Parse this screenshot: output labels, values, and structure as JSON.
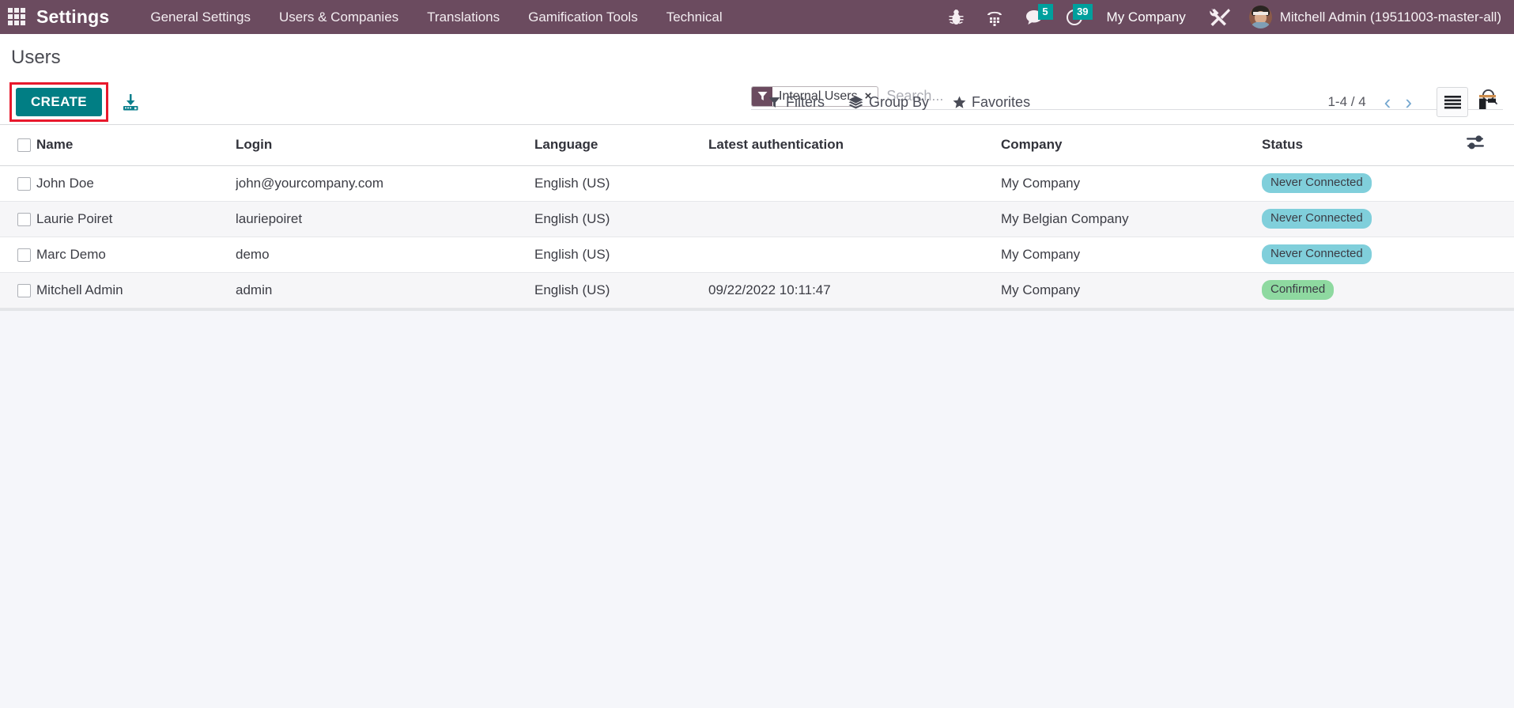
{
  "navbar": {
    "apps_icon": "apps-grid-icon",
    "brand": "Settings",
    "menu": [
      {
        "label": "General Settings"
      },
      {
        "label": "Users & Companies"
      },
      {
        "label": "Translations"
      },
      {
        "label": "Gamification Tools"
      },
      {
        "label": "Technical"
      }
    ],
    "sys_icons": [
      {
        "name": "bug-icon",
        "badge": null
      },
      {
        "name": "voip-dialpad-icon",
        "badge": null
      },
      {
        "name": "messaging-icon",
        "badge": "5"
      },
      {
        "name": "activities-clock-icon",
        "badge": "39"
      }
    ],
    "company": "My Company",
    "debug_icon": "tools-wrench-icon",
    "user": "Mitchell Admin (19511003-master-all)",
    "colors": {
      "background": "#6b4b5f",
      "badge": "#00a09d"
    }
  },
  "control_panel": {
    "breadcrumb": "Users",
    "create_label": "CREATE",
    "create_color": "#017e84",
    "highlight_color": "#e8192c",
    "import_icon": "import-download-icon",
    "search": {
      "facet_label": "Internal Users",
      "facet_icon": "filter-funnel-icon",
      "facet_remove": "×",
      "placeholder": "Search...",
      "value": "",
      "search_icon": "search-magnifier-icon"
    },
    "tools": [
      {
        "label": "Filters",
        "icon": "filter-funnel-icon"
      },
      {
        "label": "Group By",
        "icon": "layers-stack-icon"
      },
      {
        "label": "Favorites",
        "icon": "star-icon"
      }
    ],
    "pager": {
      "range": "1-4 / 4",
      "prev_icon": "chevron-left-icon",
      "next_icon": "chevron-right-icon"
    },
    "views": [
      {
        "name": "list-view",
        "icon": "list-icon",
        "active": true
      },
      {
        "name": "kanban-view",
        "icon": "kanban-icon",
        "active": false
      }
    ]
  },
  "list": {
    "columns": [
      {
        "key": "name",
        "label": "Name"
      },
      {
        "key": "login",
        "label": "Login"
      },
      {
        "key": "lang",
        "label": "Language"
      },
      {
        "key": "auth",
        "label": "Latest authentication"
      },
      {
        "key": "company",
        "label": "Company"
      },
      {
        "key": "status",
        "label": "Status"
      }
    ],
    "optional_columns_icon": "sliders-toggle-icon",
    "rows": [
      {
        "name": "John Doe",
        "login": "john@yourcompany.com",
        "lang": "English (US)",
        "auth": "",
        "company": "My Company",
        "status": "Never Connected",
        "status_type": "never"
      },
      {
        "name": "Laurie Poiret",
        "login": "lauriepoiret",
        "lang": "English (US)",
        "auth": "",
        "company": "My Belgian Company",
        "status": "Never Connected",
        "status_type": "never"
      },
      {
        "name": "Marc Demo",
        "login": "demo",
        "lang": "English (US)",
        "auth": "",
        "company": "My Company",
        "status": "Never Connected",
        "status_type": "never"
      },
      {
        "name": "Mitchell Admin",
        "login": "admin",
        "lang": "English (US)",
        "auth": "09/22/2022 10:11:47",
        "company": "My Company",
        "status": "Confirmed",
        "status_type": "confirmed"
      }
    ],
    "badge_colors": {
      "never": "#80cfdb",
      "confirmed": "#8ed9a0"
    }
  }
}
